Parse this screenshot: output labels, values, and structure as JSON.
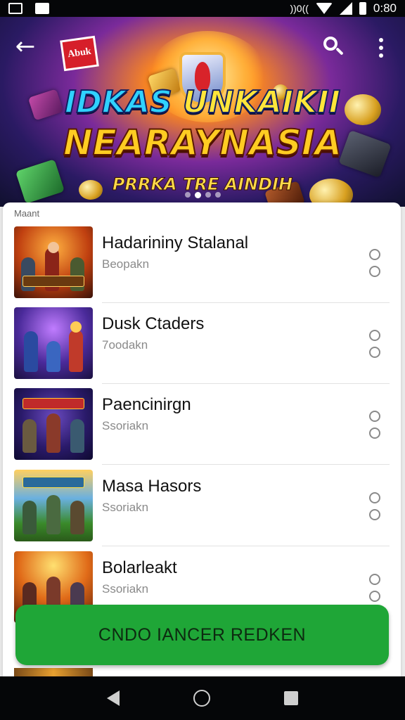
{
  "status_bar": {
    "time": "0:80",
    "icons": [
      "image-icon",
      "gallery-icon",
      "vibrate-icon",
      "wifi-icon",
      "signal-icon",
      "battery-icon"
    ],
    "vibrate_text": "))0(("
  },
  "app_bar": {
    "back_icon": "arrow-left-icon",
    "search_icon": "search-icon",
    "menu_icon": "more-vertical-icon"
  },
  "banner": {
    "logo_text": "Abuk",
    "title_line1_a": "IDKAS ",
    "title_line1_b": "UNKAIKII",
    "title_line2": "NEARAYNASIA",
    "subtitle": "PRRKA TRE AINDIH",
    "pager_count": 4,
    "pager_active_index": 1
  },
  "list": {
    "section_label": "Maant",
    "items": [
      {
        "name": "Hadarininy Stalanal",
        "sub": "Beopakn"
      },
      {
        "name": "Dusk Ctaders",
        "sub": "7oodakn"
      },
      {
        "name": "Paencinirgn",
        "sub": "Ssoriakn"
      },
      {
        "name": "Masa Hasors",
        "sub": "Ssoriakn"
      },
      {
        "name": "Bolarleakt",
        "sub": "Ssoriakn"
      }
    ]
  },
  "primary_button": {
    "label": "CNDO IANCER REDKEN"
  },
  "nav_bar": {
    "icons": [
      "nav-back-icon",
      "nav-home-icon",
      "nav-recents-icon"
    ]
  },
  "colors": {
    "primary_button": "#1fa637",
    "status_bar": "#050608",
    "card": "#ffffff",
    "subtitle_text": "#8a8a8a"
  }
}
